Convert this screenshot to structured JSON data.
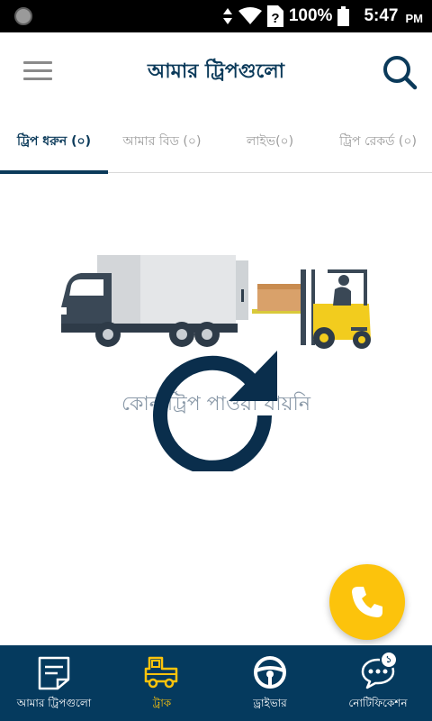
{
  "status_bar": {
    "battery_percent": "100%",
    "time": "5:47",
    "ampm": "PM",
    "icons": [
      "android-dot-icon",
      "data-arrows-icon",
      "wifi-icon",
      "sim-unknown-icon",
      "battery-icon"
    ]
  },
  "app_bar": {
    "title": "আমার ট্রিপগুলো",
    "menu_icon": "menu-icon",
    "search_icon": "search-icon"
  },
  "tabs": [
    {
      "label": "ট্রিপ ধরুন (০)",
      "active": true
    },
    {
      "label": "আমার বিড (০)",
      "active": false
    },
    {
      "label": "লাইভ(০)",
      "active": false
    },
    {
      "label": "ট্রিপ রেকর্ড (০)",
      "active": false
    }
  ],
  "empty_state": {
    "message": "কোন ট্রিপ পাওয়া যায়নি",
    "illustration": "truck-forklift-illustration",
    "refresh_icon": "refresh-icon"
  },
  "fab": {
    "icon": "phone-icon"
  },
  "bottom_nav": [
    {
      "label": "আমার ট্রিপগুলো",
      "icon": "trips-icon",
      "active": false
    },
    {
      "label": "ট্রাক",
      "icon": "truck-icon",
      "active": true
    },
    {
      "label": "ড্রাইভার",
      "icon": "steering-wheel-icon",
      "active": false
    },
    {
      "label": "নোটিফিকেশন",
      "icon": "chat-notification-icon",
      "active": false,
      "badge": "১"
    }
  ],
  "colors": {
    "primary": "#0b3a5a",
    "bottom_nav_bg": "#053a5e",
    "accent": "#fcc30c",
    "tab_inactive": "#9a9a9a"
  }
}
